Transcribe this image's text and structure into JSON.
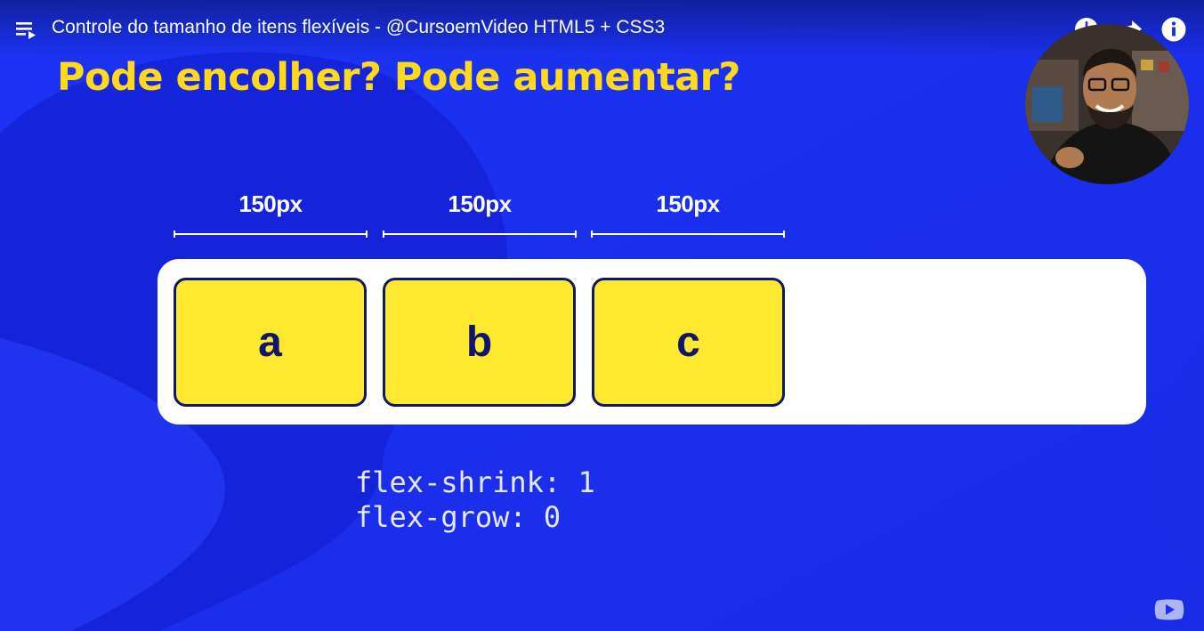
{
  "player": {
    "title": "Controle do tamanho de itens flexíveis - @CursoemVideo HTML5 + CSS3",
    "icons": [
      "playlist-icon",
      "watch-later-icon",
      "share-icon",
      "info-icon",
      "youtube-logo-icon"
    ]
  },
  "slide": {
    "heading": "Pode encolher? Pode aumentar?",
    "measures": [
      "150px",
      "150px",
      "150px"
    ],
    "items": [
      "a",
      "b",
      "c"
    ],
    "code_line_1": "flex-shrink: 1",
    "code_line_2": "flex-grow: 0"
  },
  "colors": {
    "background": "#1a2ff0",
    "heading": "#ffd91a",
    "item_fill": "#ffe92e",
    "item_border": "#10156e",
    "container": "#ffffff"
  }
}
